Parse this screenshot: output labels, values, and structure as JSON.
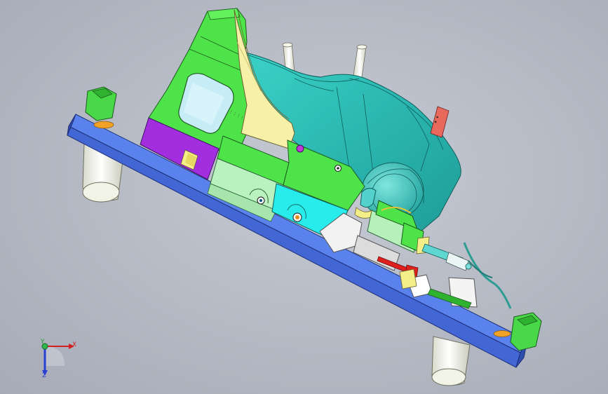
{
  "viewport": {
    "background_color": "#b8bcc6",
    "model": "fixture-assembly",
    "colors": {
      "base_plate": "#4b75e3",
      "green_block": "#4fe34a",
      "purple_block": "#a32ee0",
      "cyan_part": "#36c6c0",
      "yellow_rib": "#f6f0a8",
      "light_green": "#b9f2bf",
      "cyan_block": "#28ecec",
      "red_pin": "#e0201c",
      "leg": "#e9ebdd"
    }
  },
  "triad": {
    "x_label": "X",
    "y_label": "Y",
    "z_label": "Z"
  }
}
